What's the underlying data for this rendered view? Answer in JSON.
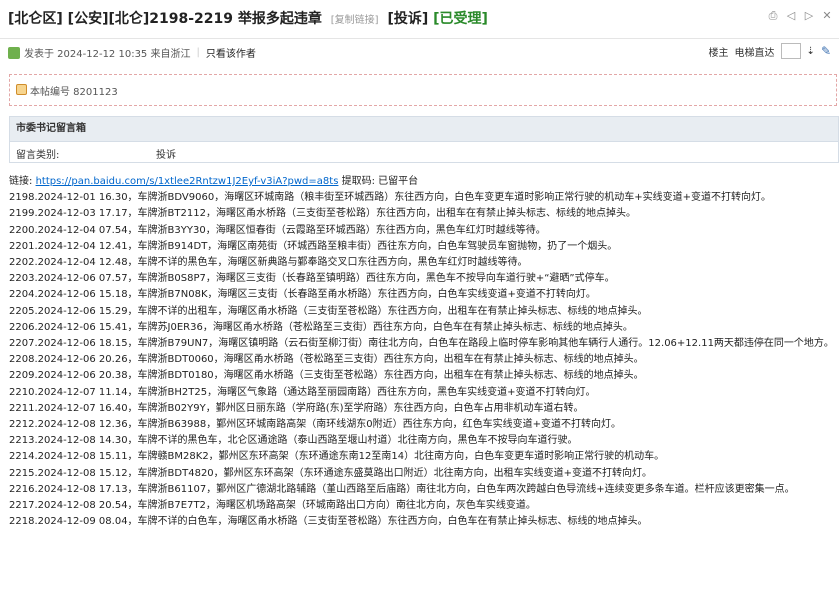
{
  "title": {
    "district": "[北仑区]",
    "category": "[公安][北仑]",
    "headline": "2198-2219 举报多起违章",
    "copy_link": "[复制链接]",
    "complaint_tag": "[投诉]",
    "status_tag": "[已受理]"
  },
  "meta": {
    "posted_text": "发表于 2024-12-12 10:35 来自浙江",
    "author_only": "只看该作者",
    "floor_label": "楼主",
    "elevator_label": "电梯直达"
  },
  "notice": {
    "text": "本帖编号 8201123"
  },
  "box": {
    "header": "市委书记留言箱",
    "type_label": "留言类别:",
    "type_value": "投诉"
  },
  "content": {
    "link_prefix": "链接: ",
    "link_url": "https://pan.baidu.com/s/1xtlee2Rntzw1J2Eyf-v3iA?pwd=a8ts",
    "link_suffix": " 提取码: 已留平台",
    "lines": [
      "2198.2024-12-01 16.30，车牌浙BDV9060，海曙区环城南路（粮丰街至环城西路）东往西方向，白色车变更车道时影响正常行驶的机动车+实线变道+变道不打转向灯。",
      "2199.2024-12-03 17.17，车牌浙BT2112，海曙区甬水桥路（三支街至苍松路）东往西方向，出租车在有禁止掉头标志、标线的地点掉头。",
      "2200.2024-12-04 07.54，车牌浙B3YY30，海曙区恒春街（云霞路至环城西路）东往西方向，黑色车红灯时越线等待。",
      "2201.2024-12-04 12.41，车牌浙B914DT，海曙区南苑街（环城西路至粮丰街）西往东方向，白色车驾驶员车窗抛物，扔了一个烟头。",
      "2202.2024-12-04 12.48，车牌不详的黑色车，海曙区新典路与鄞奉路交叉口东往西方向，黑色车红灯时越线等待。",
      "2203.2024-12-06 07.57，车牌浙B0S8P7，海曙区三支街（长春路至镇明路）西往东方向，黑色车不按导向车道行驶+“避晒”式停车。",
      "2204.2024-12-06 15.18，车牌浙B7N08K，海曙区三支街（长春路至甬水桥路）东往西方向，白色车实线变道+变道不打转向灯。",
      "2205.2024-12-06 15.29，车牌不详的出租车，海曙区甬水桥路（三支街至苍松路）东往西方向，出租车在有禁止掉头标志、标线的地点掉头。",
      "2206.2024-12-06 15.41，车牌苏J0ER36，海曙区甬水桥路（苍松路至三支街）西往东方向，白色车在有禁止掉头标志、标线的地点掉头。",
      "2207.2024-12-06 18.15，车牌浙B79UN7，海曙区镇明路（云石街至柳汀街）南往北方向，白色车在路段上临时停车影响其他车辆行人通行。12.06+12.11两天都违停在同一个地方。",
      "2208.2024-12-06 20.26，车牌浙BDT0060，海曙区甬水桥路（苍松路至三支街）西往东方向，出租车在有禁止掉头标志、标线的地点掉头。",
      "2209.2024-12-06 20.38，车牌浙BDT0180，海曙区甬水桥路（三支街至苍松路）东往西方向，出租车在有禁止掉头标志、标线的地点掉头。",
      "2210.2024-12-07 11.14，车牌浙BH2T25，海曙区气象路（通达路至丽园南路）西往东方向，黑色车实线变道+变道不打转向灯。",
      "2211.2024-12-07 16.40，车牌浙B02Y9Y，鄞州区日丽东路（学府路(东)至学府路）东往西方向，白色车占用非机动车道右转。",
      "2212.2024-12-08 12.36，车牌浙B63988，鄞州区环城南路高架（南环线湖东0附近）西往东方向，红色车实线变道+变道不打转向灯。",
      "2213.2024-12-08 14.30，车牌不详的黑色车，北仑区通途路（泰山西路至堰山村道）北往南方向，黑色车不按导向车道行驶。",
      "2214.2024-12-08 15.11，车牌赣BM28K2，鄞州区东环高架（东环通途东南12至南14）北往南方向，白色车变更车道时影响正常行驶的机动车。",
      "2215.2024-12-08 15.12，车牌浙BDT4820，鄞州区东环高架（东环通途东盛莫路出口附近）北往南方向，出租车实线变道+变道不打转向灯。",
      "2216.2024-12-08 17.13，车牌浙B61107，鄞州区广德湖北路辅路（堇山西路至后庙路）南往北方向，白色车两次跨越白色导流线+连续变更多条车道。栏杆应该更密集一点。",
      "2217.2024-12-08 20.54，车牌浙B7E7T2，海曙区机场路高架（环城南路出口方向）南往北方向，灰色车实线变道。",
      "2218.2024-12-09 08.04，车牌不详的白色车，海曙区甬水桥路（三支街至苍松路）东往西方向，白色车在有禁止掉头标志、标线的地点掉头。"
    ]
  }
}
